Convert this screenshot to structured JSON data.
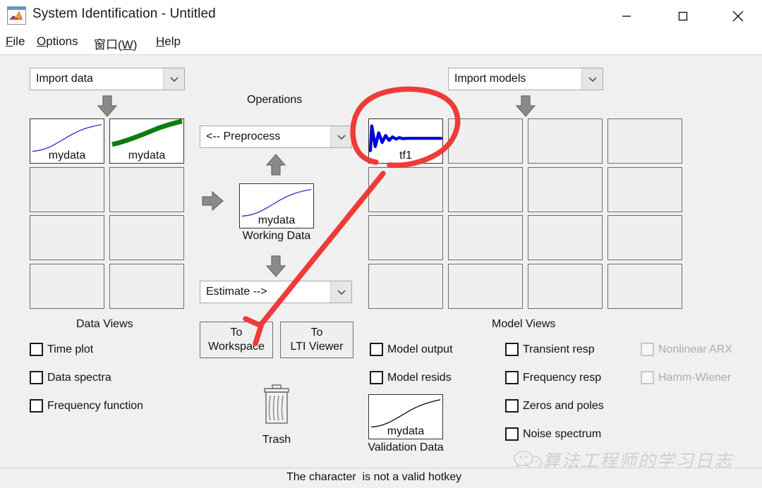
{
  "window": {
    "title": "System Identification - Untitled",
    "icon": "matlab-icon",
    "controls": {
      "minimize": "minimize-icon",
      "maximize": "maximize-icon",
      "close": "close-icon"
    }
  },
  "menubar": {
    "items": [
      {
        "label": "File",
        "mnemonic": "F"
      },
      {
        "label": "Options",
        "mnemonic": "O"
      },
      {
        "label": "窗口(W)",
        "mnemonic": "W"
      },
      {
        "label": "Help",
        "mnemonic": "H"
      }
    ]
  },
  "data_panel": {
    "import_combo": {
      "value": "Import data",
      "arrow": "chevron-down-icon"
    },
    "section_label": "Data Views",
    "cells": [
      {
        "label": "mydata",
        "filled": true,
        "curve": "blue-sigmoid"
      },
      {
        "label": "mydata",
        "filled": true,
        "curve": "green-thick-sigmoid"
      },
      {
        "label": "",
        "filled": false,
        "curve": ""
      },
      {
        "label": "",
        "filled": false,
        "curve": ""
      },
      {
        "label": "",
        "filled": false,
        "curve": ""
      },
      {
        "label": "",
        "filled": false,
        "curve": ""
      },
      {
        "label": "",
        "filled": false,
        "curve": ""
      },
      {
        "label": "",
        "filled": false,
        "curve": ""
      }
    ],
    "checkboxes": [
      {
        "label": "Time plot",
        "checked": false,
        "enabled": true
      },
      {
        "label": "Data spectra",
        "checked": false,
        "enabled": true
      },
      {
        "label": "Frequency function",
        "checked": false,
        "enabled": true
      }
    ]
  },
  "operations": {
    "title": "Operations",
    "preprocess_combo": {
      "value": "<-- Preprocess",
      "arrow": "chevron-down-icon"
    },
    "working_data": {
      "label": "mydata",
      "caption": "Working Data",
      "curve": "blue-sigmoid"
    },
    "estimate_combo": {
      "value": "Estimate -->",
      "arrow": "chevron-down-icon"
    },
    "buttons": [
      {
        "line1": "To",
        "line2": "Workspace"
      },
      {
        "line1": "To",
        "line2": "LTI Viewer"
      }
    ],
    "trash": {
      "label": "Trash",
      "icon": "trash-icon"
    },
    "validation_data": {
      "label": "mydata",
      "caption": "Validation Data",
      "curve": "black-sigmoid"
    },
    "model_checkboxes": [
      {
        "label": "Model output",
        "checked": false,
        "enabled": true
      },
      {
        "label": "Model resids",
        "checked": false,
        "enabled": true
      }
    ]
  },
  "model_panel": {
    "import_combo": {
      "value": "Import models",
      "arrow": "chevron-down-icon"
    },
    "section_label": "Model Views",
    "cells": [
      {
        "label": "tf1",
        "filled": true,
        "curve": "blue-damped-step"
      },
      {
        "label": "",
        "filled": false,
        "curve": ""
      },
      {
        "label": "",
        "filled": false,
        "curve": ""
      },
      {
        "label": "",
        "filled": false,
        "curve": ""
      },
      {
        "label": "",
        "filled": false,
        "curve": ""
      },
      {
        "label": "",
        "filled": false,
        "curve": ""
      },
      {
        "label": "",
        "filled": false,
        "curve": ""
      },
      {
        "label": "",
        "filled": false,
        "curve": ""
      },
      {
        "label": "",
        "filled": false,
        "curve": ""
      },
      {
        "label": "",
        "filled": false,
        "curve": ""
      },
      {
        "label": "",
        "filled": false,
        "curve": ""
      },
      {
        "label": "",
        "filled": false,
        "curve": ""
      },
      {
        "label": "",
        "filled": false,
        "curve": ""
      },
      {
        "label": "",
        "filled": false,
        "curve": ""
      },
      {
        "label": "",
        "filled": false,
        "curve": ""
      },
      {
        "label": "",
        "filled": false,
        "curve": ""
      }
    ],
    "checkboxes_left": [
      {
        "label": "Transient resp",
        "checked": false,
        "enabled": true
      },
      {
        "label": "Frequency resp",
        "checked": false,
        "enabled": true
      },
      {
        "label": "Zeros and poles",
        "checked": false,
        "enabled": true
      },
      {
        "label": "Noise spectrum",
        "checked": false,
        "enabled": true
      }
    ],
    "checkboxes_right": [
      {
        "label": "Nonlinear ARX",
        "checked": false,
        "enabled": false
      },
      {
        "label": "Hamm-Wiener",
        "checked": false,
        "enabled": false
      }
    ]
  },
  "statusbar": {
    "text": "The character  is not a valid hotkey"
  },
  "watermark": {
    "icon": "wechat-icon",
    "text": "算法工程师的学习日志"
  },
  "annotations": {
    "color": "#ee3b38",
    "shapes": [
      "circle-around-tf1",
      "arrow-to-workspace"
    ]
  },
  "colors": {
    "background": "#f0f0f0",
    "cell_border": "#6e6e6e",
    "annotation_red": "#ee3b38",
    "curve_blue": "#3333cc",
    "curve_green": "#107c10",
    "model_curve_blue": "#0000dd",
    "arrow_gray": "#808080"
  }
}
